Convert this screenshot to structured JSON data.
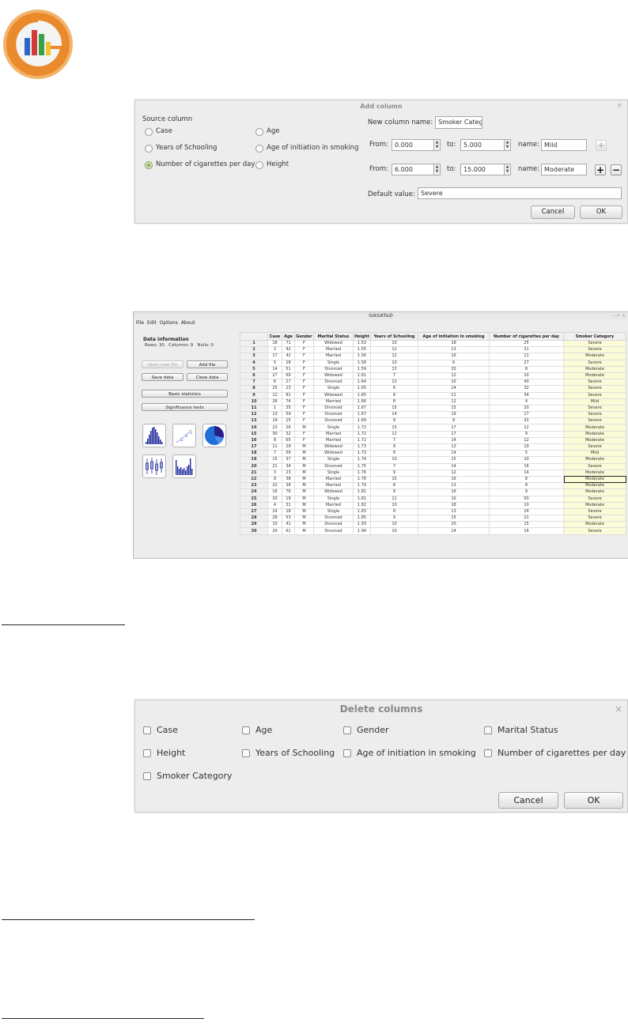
{
  "add_column": {
    "title": "Add column",
    "close": "×",
    "source_label": "Source column",
    "options": [
      "Case",
      "Age",
      "Years of Schooling",
      "Age of initiation in smoking",
      "Number of cigarettes per day",
      "Height"
    ],
    "selected_option": "Number of cigarettes per day",
    "new_name_label": "New column name:",
    "new_name_value": "Smoker Categ",
    "from_label": "From:",
    "to_label": "to:",
    "name_label": "name:",
    "ranges": [
      {
        "from": "0.000",
        "to": "5.000",
        "name": "Mild"
      },
      {
        "from": "6.000",
        "to": "15.000",
        "name": "Moderate"
      }
    ],
    "default_label": "Default value:",
    "default_value": "Severe",
    "cancel": "Cancel",
    "ok": "OK"
  },
  "app": {
    "title": "GASATaD",
    "window_controls": "– + ×",
    "menu": [
      "File",
      "Edit",
      "Options",
      "About"
    ],
    "info_title": "Data information",
    "info_rows": "Rows: 30",
    "info_cols": "Columns: 9",
    "info_nulls": "Nulls: 0",
    "btn_open": "Open new file",
    "btn_add": "Add file",
    "btn_save": "Save data",
    "btn_close": "Close data",
    "btn_basic": "Basic statistics",
    "btn_sig": "Significance tests",
    "chart_icons": [
      "histogram-icon",
      "scatter-plot-icon",
      "pie-chart-icon",
      "boxplot-icon",
      "bar-chart-icon"
    ],
    "columns": [
      "",
      "Case",
      "Age",
      "Gender",
      "Marital Status",
      "Height",
      "Years of Schooling",
      "Age of initiation in smoking",
      "Number of cigarettes per day",
      "Smoker Category"
    ],
    "rows": [
      [
        "1",
        "18",
        "71",
        "F",
        "Widowed",
        "1.53",
        "10",
        "18",
        "25",
        "Severe"
      ],
      [
        "2",
        "2",
        "42",
        "F",
        "Married",
        "1.55",
        "12",
        "13",
        "21",
        "Severe"
      ],
      [
        "3",
        "17",
        "42",
        "F",
        "Married",
        "1.56",
        "12",
        "16",
        "11",
        "Moderate"
      ],
      [
        "4",
        "5",
        "18",
        "F",
        "Single",
        "1.58",
        "10",
        "9",
        "27",
        "Severe"
      ],
      [
        "5",
        "14",
        "51",
        "F",
        "Divorced",
        "1.59",
        "13",
        "20",
        "8",
        "Moderate"
      ],
      [
        "6",
        "27",
        "69",
        "F",
        "Widowed",
        "1.61",
        "7",
        "12",
        "10",
        "Moderate"
      ],
      [
        "7",
        "6",
        "27",
        "F",
        "Divorced",
        "1.64",
        "12",
        "10",
        "40",
        "Severe"
      ],
      [
        "8",
        "25",
        "23",
        "F",
        "Single",
        "1.65",
        "6",
        "14",
        "32",
        "Severe"
      ],
      [
        "9",
        "12",
        "81",
        "F",
        "Widowed",
        "1.65",
        "8",
        "11",
        "34",
        "Severe"
      ],
      [
        "10",
        "26",
        "74",
        "F",
        "Married",
        "1.66",
        "8",
        "12",
        "4",
        "Mild"
      ],
      [
        "11",
        "1",
        "35",
        "F",
        "Divorced",
        "1.67",
        "15",
        "15",
        "20",
        "Severe"
      ],
      [
        "12",
        "13",
        "59",
        "F",
        "Divorced",
        "1.67",
        "14",
        "19",
        "17",
        "Severe"
      ],
      [
        "13",
        "19",
        "25",
        "F",
        "Divorced",
        "1.69",
        "9",
        "9",
        "32",
        "Severe"
      ],
      [
        "14",
        "23",
        "26",
        "M",
        "Single",
        "1.72",
        "15",
        "17",
        "12",
        "Moderate"
      ],
      [
        "15",
        "30",
        "32",
        "F",
        "Married",
        "1.72",
        "12",
        "17",
        "9",
        "Moderate"
      ],
      [
        "16",
        "8",
        "65",
        "F",
        "Married",
        "1.72",
        "7",
        "14",
        "12",
        "Moderate"
      ],
      [
        "17",
        "11",
        "29",
        "M",
        "Widowed",
        "1.73",
        "9",
        "13",
        "19",
        "Severe"
      ],
      [
        "18",
        "7",
        "56",
        "M",
        "Widowed",
        "1.73",
        "8",
        "14",
        "5",
        "Mild"
      ],
      [
        "19",
        "15",
        "37",
        "M",
        "Single",
        "1.74",
        "10",
        "15",
        "10",
        "Moderate"
      ],
      [
        "20",
        "21",
        "34",
        "M",
        "Divorced",
        "1.75",
        "7",
        "14",
        "16",
        "Severe"
      ],
      [
        "21",
        "3",
        "23",
        "M",
        "Single",
        "1.76",
        "9",
        "12",
        "14",
        "Moderate"
      ],
      [
        "22",
        "9",
        "38",
        "M",
        "Married",
        "1.78",
        "15",
        "16",
        "8",
        "Moderate"
      ],
      [
        "23",
        "22",
        "39",
        "M",
        "Married",
        "1.79",
        "8",
        "13",
        "8",
        "Moderate"
      ],
      [
        "24",
        "16",
        "76",
        "M",
        "Widowed",
        "1.81",
        "8",
        "16",
        "9",
        "Moderate"
      ],
      [
        "25",
        "20",
        "19",
        "M",
        "Single",
        "1.81",
        "11",
        "10",
        "50",
        "Severe"
      ],
      [
        "26",
        "4",
        "31",
        "M",
        "Married",
        "1.82",
        "10",
        "18",
        "10",
        "Moderate"
      ],
      [
        "27",
        "24",
        "18",
        "M",
        "Single",
        "1.83",
        "8",
        "13",
        "24",
        "Severe"
      ],
      [
        "28",
        "28",
        "53",
        "M",
        "Divorced",
        "1.85",
        "9",
        "15",
        "21",
        "Severe"
      ],
      [
        "29",
        "10",
        "41",
        "M",
        "Divorced",
        "1.93",
        "10",
        "20",
        "15",
        "Moderate"
      ],
      [
        "30",
        "29",
        "61",
        "M",
        "Divorced",
        "1.94",
        "10",
        "14",
        "16",
        "Severe"
      ]
    ],
    "selected_row": "22"
  },
  "delete_columns": {
    "title": "Delete columns",
    "close": "×",
    "options": [
      "Case",
      "Age",
      "Gender",
      "Marital Status",
      "Height",
      "Years of Schooling",
      "Age of initiation in smoking",
      "Number of cigarettes per day",
      "Smoker Category"
    ],
    "cancel": "Cancel",
    "ok": "OK"
  }
}
